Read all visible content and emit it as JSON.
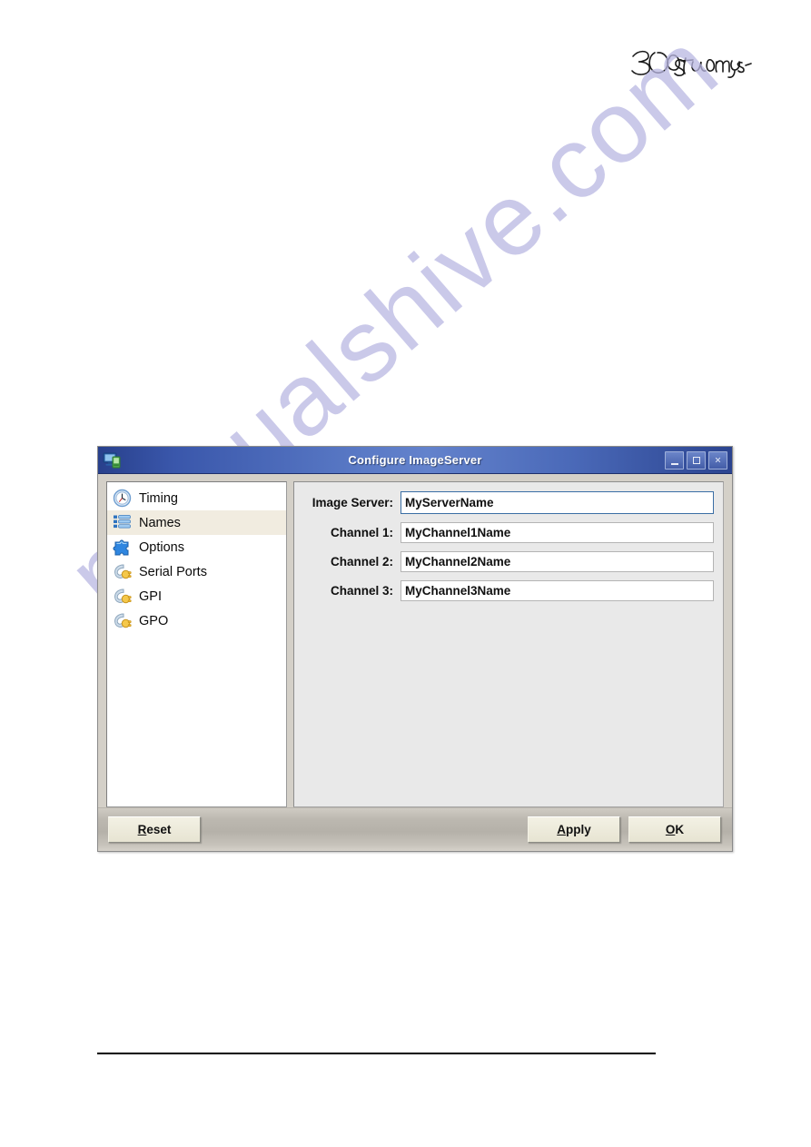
{
  "page": {
    "brand_logo_text": "360 Systems",
    "watermark_text": "manualshive.com"
  },
  "dialog": {
    "title": "Configure ImageServer",
    "window_icon": "computer-server-icon",
    "window_controls": [
      {
        "name": "minimize",
        "glyph": "–"
      },
      {
        "name": "maximize",
        "glyph": "□"
      },
      {
        "name": "close",
        "glyph": "×"
      }
    ],
    "sidebar": {
      "items": [
        {
          "label": "Timing",
          "icon": "clock-icon",
          "selected": false
        },
        {
          "label": "Names",
          "icon": "list-icon",
          "selected": true
        },
        {
          "label": "Options",
          "icon": "puzzle-piece-icon",
          "selected": false
        },
        {
          "label": "Serial Ports",
          "icon": "plug-icon",
          "selected": false
        },
        {
          "label": "GPI",
          "icon": "plug-icon",
          "selected": false
        },
        {
          "label": "GPO",
          "icon": "plug-icon",
          "selected": false
        }
      ]
    },
    "form": {
      "fields": [
        {
          "label": "Image Server:",
          "value": "MyServerName",
          "focused": true
        },
        {
          "label": "Channel 1:",
          "value": "MyChannel1Name",
          "focused": false
        },
        {
          "label": "Channel 2:",
          "value": "MyChannel2Name",
          "focused": false
        },
        {
          "label": "Channel 3:",
          "value": "MyChannel3Name",
          "focused": false
        }
      ]
    },
    "buttons": {
      "reset": {
        "label": "Reset",
        "accel": "R"
      },
      "apply": {
        "label": "Apply",
        "accel": "A"
      },
      "ok": {
        "label": "OK",
        "accel": "O"
      }
    }
  },
  "colors": {
    "titlebar_blue": "#3a57ab",
    "dialog_face": "#d4d0c8",
    "panel_bg": "#e9e9e9",
    "selection": "#f1ece0",
    "button_face": "#ece9d8",
    "focus_border": "#3a6ea5",
    "watermark": "#b9b7e2"
  }
}
